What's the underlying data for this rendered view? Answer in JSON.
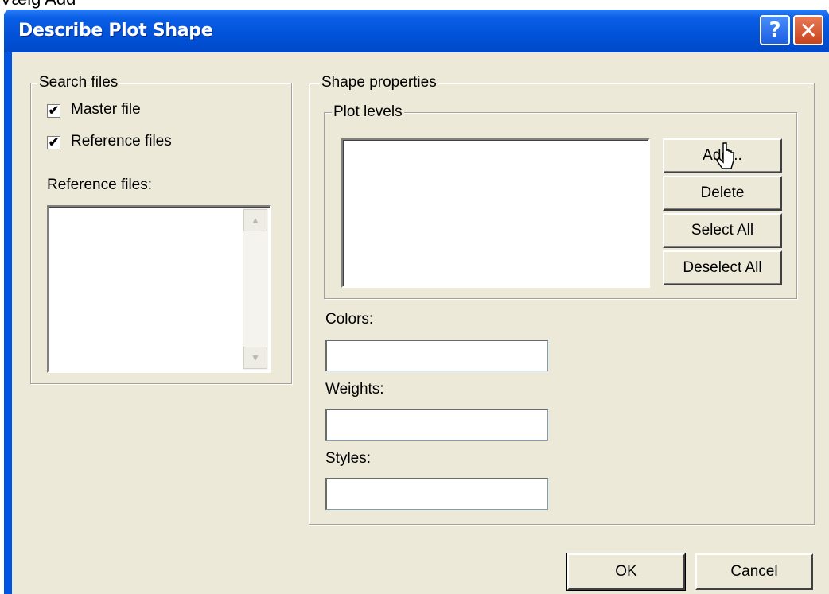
{
  "caption": "Vælg Add",
  "dialog": {
    "title": "Describe Plot Shape",
    "help_glyph": "?",
    "close_glyph": "✕"
  },
  "search_files": {
    "legend": "Search files",
    "master_label": "Master file",
    "master_checked": true,
    "reference_label": "Reference files",
    "reference_checked": true,
    "reference_list_label": "Reference files:",
    "check_glyph": "✔",
    "scroll_up_glyph": "▲",
    "scroll_down_glyph": "▼"
  },
  "shape_properties": {
    "legend": "Shape properties",
    "plot_levels_legend": "Plot levels",
    "buttons": {
      "add": "Add...",
      "delete": "Delete",
      "select_all": "Select All",
      "deselect_all": "Deselect All"
    },
    "colors_label": "Colors:",
    "colors_value": "",
    "weights_label": "Weights:",
    "weights_value": "",
    "styles_label": "Styles:",
    "styles_value": ""
  },
  "footer": {
    "ok": "OK",
    "cancel": "Cancel"
  }
}
